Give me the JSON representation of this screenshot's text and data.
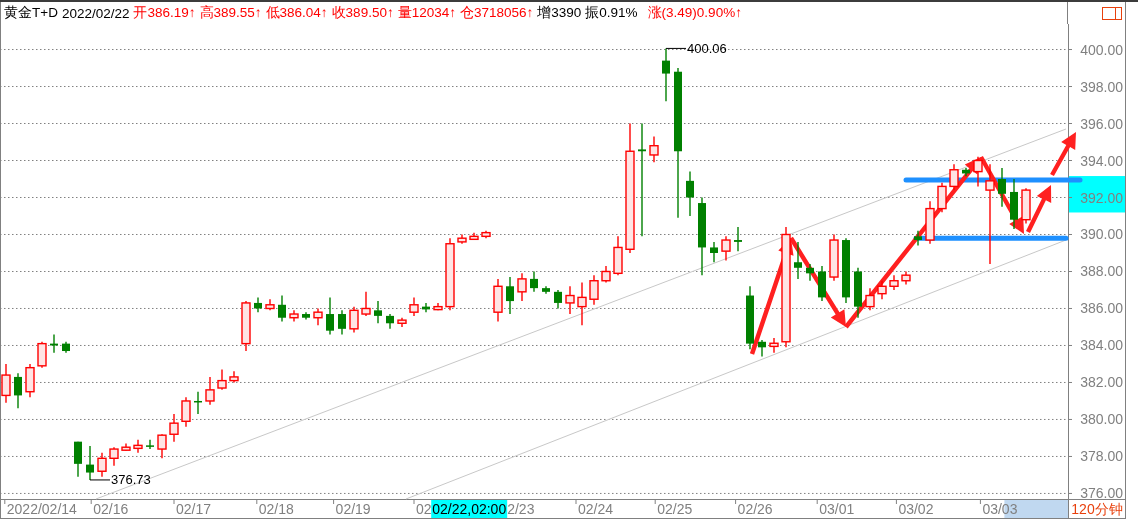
{
  "header": {
    "symbol": "黄金T+D",
    "date": "2022/02/22",
    "quotes": [
      {
        "text": "开386.19↑",
        "kind": "up"
      },
      {
        "text": "高389.55↑",
        "kind": "up"
      },
      {
        "text": "低386.04↑",
        "kind": "up"
      },
      {
        "text": "收389.50↑",
        "kind": "up"
      },
      {
        "text": "量12034↑",
        "kind": "up"
      },
      {
        "text": "仓3718056↑",
        "kind": "up"
      },
      {
        "text": "增3390",
        "kind": "plain"
      },
      {
        "text": "振0.91%",
        "kind": "plain"
      },
      {
        "text": "涨(3.49)0.90%↑",
        "kind": "up"
      }
    ]
  },
  "chart": {
    "period": "120分钟",
    "date_labels": [
      "2022/02/14",
      "02/16",
      "02/17",
      "02/18",
      "02/19",
      "02",
      "2/23",
      "02/24",
      "02/25",
      "02/26",
      "03/01",
      "03/02",
      "03/03"
    ],
    "chart_data": {
      "type": "candlestick",
      "ylim": [
        375.7,
        401.38
      ],
      "yticks": [
        {
          "value": 400,
          "label": "400.00"
        },
        {
          "value": 398,
          "label": "398.00"
        },
        {
          "value": 396,
          "label": "396.00"
        },
        {
          "value": 394,
          "label": "394.00"
        },
        {
          "value": 392,
          "label": "392.00"
        },
        {
          "value": 390,
          "label": "390.00"
        },
        {
          "value": 388,
          "label": "388.00"
        },
        {
          "value": 386,
          "label": "386.00"
        },
        {
          "value": 384,
          "label": "384.00"
        },
        {
          "value": 382,
          "label": "382.00"
        },
        {
          "value": 380,
          "label": "380.00"
        },
        {
          "value": 378,
          "label": "378.00"
        },
        {
          "value": 376,
          "label": "376.00"
        }
      ],
      "categories": [
        null,
        null,
        null,
        null,
        null,
        null,
        null,
        null,
        null,
        null,
        null,
        null,
        null,
        null,
        null,
        null,
        null,
        null,
        null,
        null,
        null,
        null,
        null,
        null,
        null,
        null,
        null,
        null,
        null,
        null,
        null,
        null,
        null,
        null,
        null,
        null,
        null,
        null,
        null,
        null,
        null,
        null,
        null,
        null,
        null,
        null,
        null,
        null,
        null,
        null,
        null,
        null,
        null,
        null,
        null,
        null,
        null,
        null,
        null,
        null,
        null,
        null,
        null,
        null,
        null,
        null,
        null,
        null,
        null,
        null,
        null,
        null,
        null,
        null,
        null,
        null,
        null,
        null,
        null,
        null,
        null,
        null,
        null,
        null,
        null,
        null,
        null,
        null,
        null
      ],
      "ohlc": [
        [
          381.3,
          383.0,
          380.9,
          382.4
        ],
        [
          382.3,
          382.5,
          380.6,
          381.3
        ],
        [
          381.5,
          383.0,
          381.2,
          382.8
        ],
        [
          382.9,
          384.2,
          382.8,
          384.1
        ],
        [
          384.1,
          384.6,
          383.6,
          384.0
        ],
        [
          384.1,
          384.2,
          383.6,
          383.7
        ],
        [
          378.8,
          378.8,
          376.9,
          377.6
        ],
        [
          377.56,
          378.57,
          376.73,
          377.13
        ],
        [
          377.2,
          378.2,
          376.9,
          377.9
        ],
        [
          377.9,
          378.5,
          377.5,
          378.4
        ],
        [
          378.4,
          378.7,
          378.3,
          378.5
        ],
        [
          378.5,
          378.9,
          378.2,
          378.6
        ],
        [
          378.6,
          378.9,
          378.4,
          378.55
        ],
        [
          378.4,
          379.2,
          377.9,
          379.15
        ],
        [
          379.2,
          380.3,
          378.8,
          379.8
        ],
        [
          379.9,
          381.2,
          379.6,
          381.0
        ],
        [
          381.0,
          381.5,
          380.3,
          380.95
        ],
        [
          381.0,
          382.3,
          380.8,
          381.6
        ],
        [
          381.7,
          382.7,
          381.6,
          382.1
        ],
        [
          382.1,
          382.6,
          382.0,
          382.3
        ],
        [
          384.1,
          386.4,
          383.7,
          386.3
        ],
        [
          386.3,
          386.6,
          385.8,
          386.0
        ],
        [
          386.0,
          386.5,
          385.9,
          386.2
        ],
        [
          386.2,
          386.7,
          385.3,
          385.5
        ],
        [
          385.5,
          385.9,
          385.3,
          385.7
        ],
        [
          385.7,
          385.8,
          385.4,
          385.5
        ],
        [
          385.5,
          386.0,
          385.1,
          385.8
        ],
        [
          385.7,
          386.6,
          384.6,
          384.8
        ],
        [
          385.7,
          385.9,
          384.6,
          384.9
        ],
        [
          384.9,
          386.1,
          384.7,
          385.9
        ],
        [
          385.7,
          386.9,
          385.6,
          386.0
        ],
        [
          385.9,
          386.4,
          385.2,
          385.6
        ],
        [
          385.6,
          385.7,
          384.9,
          385.2
        ],
        [
          385.2,
          385.5,
          385.0,
          385.37
        ],
        [
          385.8,
          386.6,
          385.6,
          386.2
        ],
        [
          386.1,
          386.3,
          385.8,
          385.95
        ],
        [
          386.0,
          386.3,
          385.9,
          386.1
        ],
        [
          386.1,
          389.8,
          385.9,
          389.5
        ],
        [
          389.6,
          390.0,
          389.5,
          389.8
        ],
        [
          389.8,
          390.1,
          389.7,
          389.9
        ],
        [
          389.9,
          390.2,
          389.8,
          390.1
        ],
        [
          385.8,
          387.6,
          385.3,
          387.2
        ],
        [
          387.2,
          387.7,
          385.7,
          386.4
        ],
        [
          386.9,
          387.9,
          386.4,
          387.6
        ],
        [
          387.6,
          388.0,
          386.9,
          387.1
        ],
        [
          387.1,
          387.2,
          386.8,
          386.9
        ],
        [
          386.9,
          387.0,
          386.0,
          386.3
        ],
        [
          386.3,
          387.2,
          385.7,
          386.7
        ],
        [
          386.1,
          387.4,
          385.1,
          386.6
        ],
        [
          386.5,
          387.8,
          386.2,
          387.5
        ],
        [
          387.5,
          388.3,
          387.4,
          388.0
        ],
        [
          387.9,
          389.9,
          387.8,
          389.3
        ],
        [
          389.2,
          396.0,
          389.0,
          394.5
        ],
        [
          394.6,
          396.0,
          389.9,
          394.5
        ],
        [
          394.3,
          395.3,
          393.9,
          394.8
        ],
        [
          399.4,
          400.06,
          397.2,
          398.7
        ],
        [
          398.8,
          399.0,
          390.9,
          394.5
        ],
        [
          392.9,
          393.4,
          391.0,
          392.0
        ],
        [
          391.7,
          392.0,
          387.8,
          389.3
        ],
        [
          389.3,
          389.6,
          388.5,
          389.0
        ],
        [
          389.1,
          389.9,
          388.6,
          389.7
        ],
        [
          389.7,
          390.4,
          389.1,
          389.6
        ],
        [
          386.7,
          387.2,
          383.8,
          384.1
        ],
        [
          384.2,
          384.3,
          383.4,
          383.9
        ],
        [
          383.95,
          384.4,
          383.6,
          384.12
        ],
        [
          384.2,
          390.4,
          383.9,
          390.0
        ],
        [
          388.5,
          389.6,
          387.6,
          388.2
        ],
        [
          388.2,
          388.4,
          387.5,
          387.9
        ],
        [
          388.0,
          388.3,
          386.4,
          386.6
        ],
        [
          387.7,
          390.0,
          387.5,
          389.7
        ],
        [
          389.7,
          389.8,
          386.3,
          386.6
        ],
        [
          388.0,
          388.2,
          385.5,
          386.1
        ],
        [
          386.1,
          387.1,
          385.9,
          386.7
        ],
        [
          386.8,
          387.5,
          386.5,
          387.2
        ],
        [
          387.2,
          387.8,
          387.0,
          387.5
        ],
        [
          387.5,
          388.0,
          387.3,
          387.8
        ],
        [
          389.9,
          390.2,
          389.4,
          389.7
        ],
        [
          389.7,
          391.8,
          389.5,
          391.4
        ],
        [
          391.4,
          392.8,
          391.2,
          392.6
        ],
        [
          392.6,
          393.8,
          392.4,
          393.5
        ],
        [
          393.5,
          393.6,
          393.15,
          393.3
        ],
        [
          393.4,
          394.2,
          392.6,
          394.0
        ],
        [
          392.4,
          393.8,
          388.4,
          392.9
        ],
        [
          393.0,
          393.6,
          391.5,
          392.2
        ],
        [
          392.3,
          393.0,
          390.3,
          390.8
        ],
        [
          390.8,
          392.5,
          390.6,
          392.4
        ],
        null,
        null,
        null
      ],
      "grid": true,
      "ref_lines": [
        {
          "axis": "y",
          "value": 392.95
        },
        {
          "axis": "y",
          "value": 389.8
        }
      ]
    },
    "high_label": "400.06",
    "low_label": "376.73",
    "cursor_label": "02/22,02:00"
  }
}
